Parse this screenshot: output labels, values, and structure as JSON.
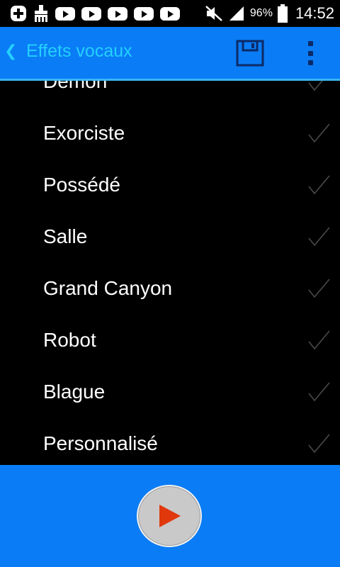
{
  "status_bar": {
    "battery_percent": "96%",
    "time": "14:52",
    "icons": [
      "add-icon",
      "cleaner-icon",
      "youtube-icon",
      "youtube-icon",
      "youtube-icon",
      "youtube-icon",
      "youtube-icon",
      "mute-icon",
      "signal-icon",
      "battery-icon"
    ]
  },
  "app_bar": {
    "title": "Effets vocaux",
    "back_icon": "chevron-left-icon",
    "save_icon": "floppy-disk-icon",
    "menu_icon": "overflow-menu-icon"
  },
  "effects": [
    {
      "label": "Démon"
    },
    {
      "label": "Exorciste"
    },
    {
      "label": "Possédé"
    },
    {
      "label": "Salle"
    },
    {
      "label": "Grand Canyon"
    },
    {
      "label": "Robot"
    },
    {
      "label": "Blague"
    },
    {
      "label": "Personnalisé"
    }
  ],
  "controls": {
    "play_icon": "play-icon"
  },
  "colors": {
    "accent": "#0a7cf5",
    "title_text": "#23d0ff",
    "divider": "#39b6f1",
    "play_arrow": "#e0380c"
  }
}
